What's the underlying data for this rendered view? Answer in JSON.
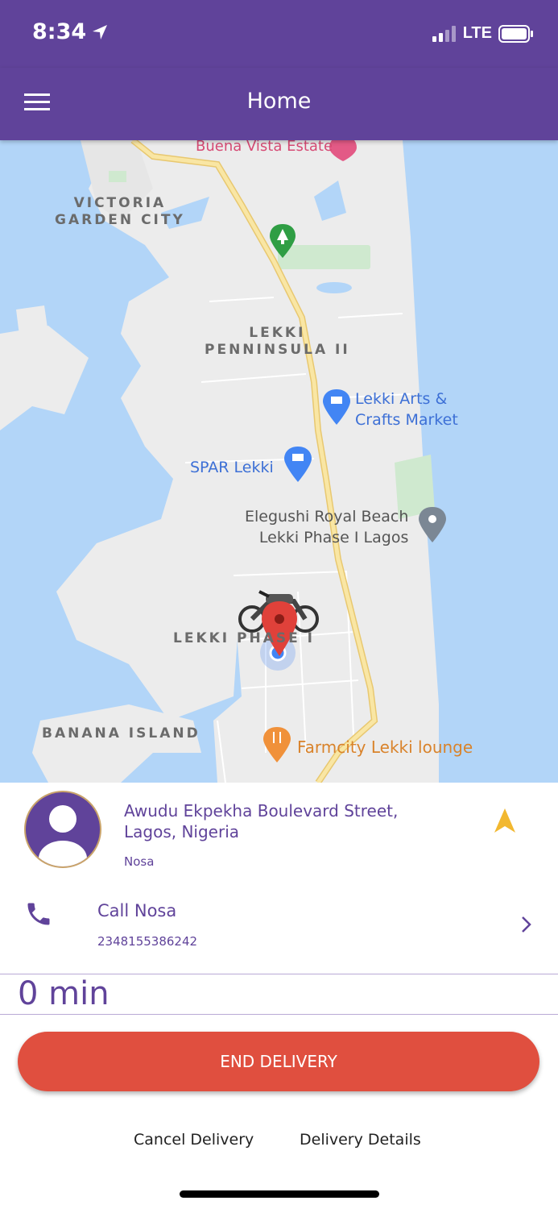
{
  "status_bar": {
    "time": "8:34",
    "network": "LTE"
  },
  "header": {
    "title": "Home"
  },
  "map": {
    "labels": {
      "buena_vista": "Buena Vista Estate",
      "victoria_garden_city": "VICTORIA\nGARDEN CITY",
      "lekki_peninsula": "LEKKI\nPENNINSULA II",
      "lekki_arts": "Lekki Arts &\nCrafts Market",
      "spar": "SPAR Lekki",
      "elegushi": "Elegushi Royal Beach\nLekki Phase I Lagos",
      "lekki_phase": "LEKKI PHASE I",
      "banana_island": "BANANA ISLAND",
      "farmcity": "Farmcity Lekki lounge"
    },
    "colors": {
      "water": "#b2d5f8",
      "land": "#ececec",
      "road": "#f7dc8a",
      "marker": "#e0413a"
    }
  },
  "delivery": {
    "address": "Awudu Ekpekha Boulevard Street,\nLagos, Nigeria",
    "customer_name": "Nosa",
    "call_label": "Call Nosa",
    "phone": "2348155386242",
    "eta": "0 min"
  },
  "actions": {
    "end_delivery": "END DELIVERY",
    "cancel_delivery": "Cancel Delivery",
    "delivery_details": "Delivery Details"
  },
  "colors": {
    "brand": "#60439a",
    "danger": "#e04f3f",
    "accent": "#f2b830"
  }
}
